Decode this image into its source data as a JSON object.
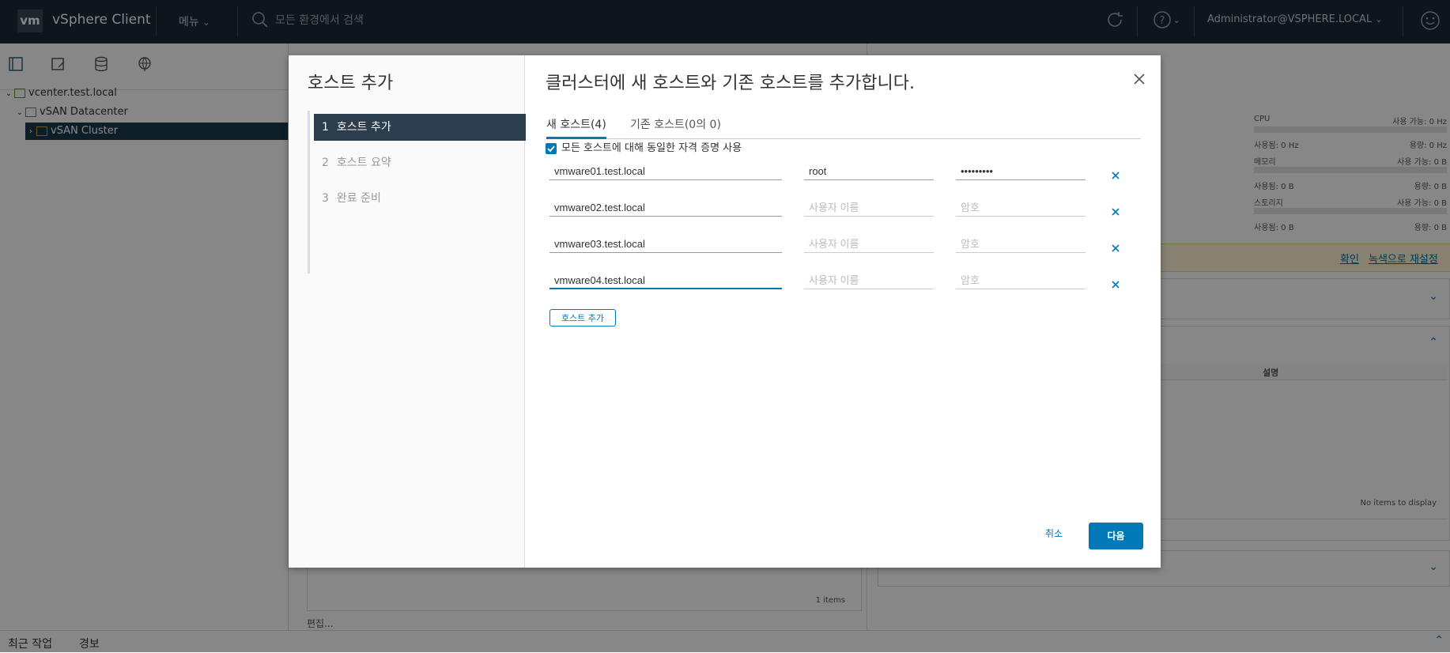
{
  "header": {
    "logo": "vm",
    "app_title": "vSphere Client",
    "menu_label": "메뉴",
    "search_placeholder": "모든 환경에서 검색",
    "user": "Administrator@VSPHERE.LOCAL"
  },
  "tree": {
    "items": [
      {
        "label": "vcenter.test.local"
      },
      {
        "label": "vSAN Datacenter"
      },
      {
        "label": "vSAN Cluster"
      }
    ]
  },
  "background": {
    "cpu_label": "CPU",
    "cpu_free": "사용 가능: 0 Hz",
    "cpu_used": "사용됨: 0 Hz",
    "cpu_capacity": "용량: 0 Hz",
    "mem_label": "메모리",
    "mem_free": "사용 가능: 0 B",
    "mem_used": "사용됨: 0 B",
    "mem_capacity": "용량: 0 B",
    "storage_label": "스토리지",
    "storage_free": "사용 가능: 0 B",
    "storage_used": "사용됨: 0 B",
    "storage_capacity": "용량: 0 B",
    "ack_link": "확인",
    "reset_link": "녹색으로 재설정",
    "desc_header": "설명",
    "no_items": "No items to display",
    "items_count": "1 items",
    "edit_link": "편집..."
  },
  "footer": {
    "recent_tasks": "최근 작업",
    "alarms": "경보"
  },
  "modal": {
    "left_title": "호스트 추가",
    "steps": [
      {
        "num": "1",
        "label": "호스트 추가"
      },
      {
        "num": "2",
        "label": "호스트 요약"
      },
      {
        "num": "3",
        "label": "완료 준비"
      }
    ],
    "title": "클러스터에 새 호스트와 기존 호스트를 추가합니다.",
    "tabs": [
      {
        "label": "새 호스트(4)"
      },
      {
        "label": "기존 호스트(0의 0)"
      }
    ],
    "same_credentials_label": "모든 호스트에 대해 동일한 자격 증명 사용",
    "username_placeholder": "사용자 이름",
    "password_placeholder": "암호",
    "hosts": [
      {
        "name": "vmware01.test.local",
        "username": "root",
        "password": "•••••••••"
      },
      {
        "name": "vmware02.test.local",
        "username": "",
        "password": ""
      },
      {
        "name": "vmware03.test.local",
        "username": "",
        "password": ""
      },
      {
        "name": "vmware04.test.local",
        "username": "",
        "password": ""
      }
    ],
    "add_host_button": "호스트 추가",
    "cancel_button": "취소",
    "next_button": "다음"
  },
  "colors": {
    "header_bg": "#1b2a37",
    "accent": "#0079b8",
    "active_step": "#2c3e4e"
  }
}
